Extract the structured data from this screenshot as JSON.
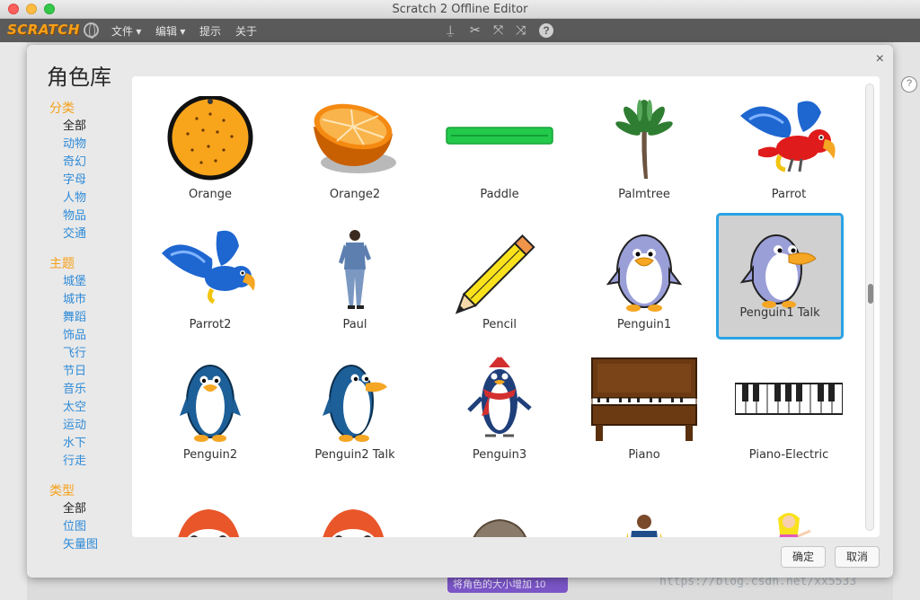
{
  "window": {
    "title": "Scratch 2 Offline Editor"
  },
  "menubar": {
    "logo": "SCRATCH",
    "items": [
      {
        "label": "文件 ▾"
      },
      {
        "label": "编辑 ▾"
      },
      {
        "label": "提示"
      },
      {
        "label": "关于"
      }
    ],
    "tools": [
      "stamp-icon",
      "cut-icon",
      "grow-icon",
      "shrink-icon",
      "help-icon"
    ]
  },
  "background": {
    "block_text": "将角色的大小增加 10",
    "watermark": "https://blog.csdn.net/xx5533"
  },
  "dialog": {
    "title": "角色库",
    "close": "×",
    "categories": {
      "group1": {
        "title": "分类",
        "items": [
          "全部",
          "动物",
          "奇幻",
          "字母",
          "人物",
          "物品",
          "交通"
        ]
      },
      "group2": {
        "title": "主题",
        "items": [
          "城堡",
          "城市",
          "舞蹈",
          "饰品",
          "飞行",
          "节日",
          "音乐",
          "太空",
          "运动",
          "水下",
          "行走"
        ]
      },
      "group3": {
        "title": "类型",
        "items": [
          "全部",
          "位图",
          "矢量图"
        ]
      }
    },
    "sprites": [
      {
        "name": "Orange",
        "icon": "orange-icon"
      },
      {
        "name": "Orange2",
        "icon": "orange-half-icon"
      },
      {
        "name": "Paddle",
        "icon": "paddle-icon"
      },
      {
        "name": "Palmtree",
        "icon": "palmtree-icon"
      },
      {
        "name": "Parrot",
        "icon": "parrot-icon"
      },
      {
        "name": "Parrot2",
        "icon": "parrot-icon"
      },
      {
        "name": "Paul",
        "icon": "person-icon"
      },
      {
        "name": "Pencil",
        "icon": "pencil-icon"
      },
      {
        "name": "Penguin1",
        "icon": "penguin-icon"
      },
      {
        "name": "Penguin1 Talk",
        "icon": "penguin-icon"
      },
      {
        "name": "Penguin2",
        "icon": "penguin-icon"
      },
      {
        "name": "Penguin2 Talk",
        "icon": "penguin-icon"
      },
      {
        "name": "Penguin3",
        "icon": "penguin-icon"
      },
      {
        "name": "Piano",
        "icon": "piano-icon"
      },
      {
        "name": "Piano-Electric",
        "icon": "keyboard-icon"
      }
    ],
    "selected": "Penguin1 Talk",
    "ok_label": "确定",
    "cancel_label": "取消"
  },
  "colors": {
    "accent": "#f6a019",
    "link": "#2f8bd8",
    "selection": "#29a3e6"
  }
}
